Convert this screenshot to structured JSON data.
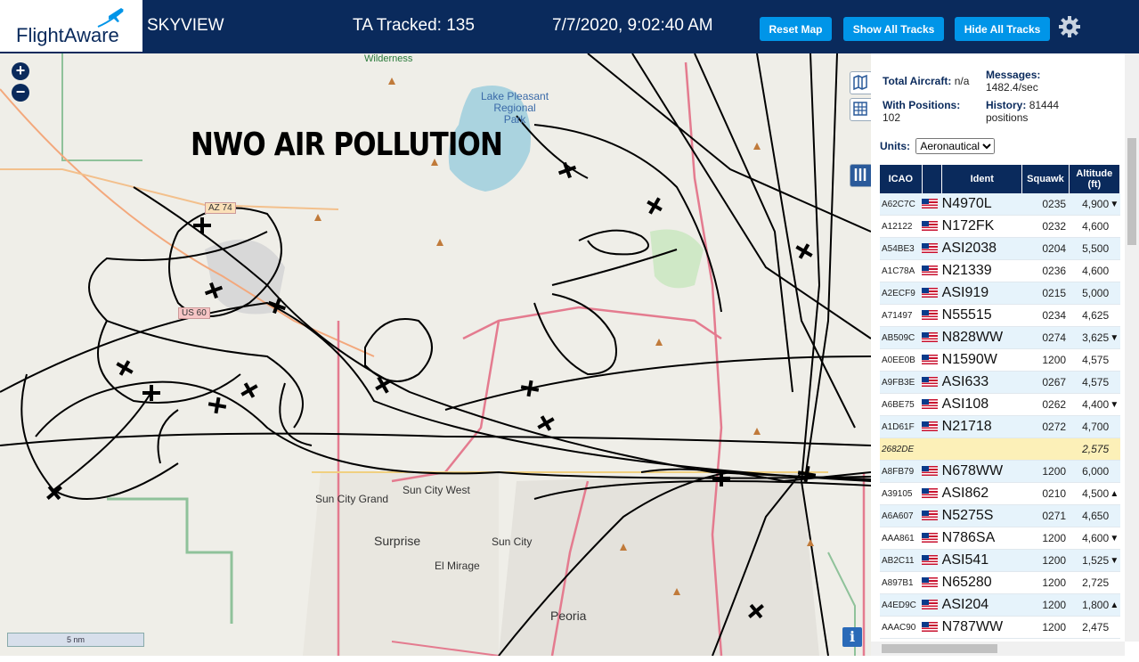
{
  "header": {
    "logo_text": "FlightAware",
    "app_name": "SKYVIEW",
    "ta_tracked": "TA Tracked: 135",
    "datetime": "7/7/2020, 9:02:40 AM",
    "buttons": {
      "reset": "Reset Map",
      "show_all": "Show All Tracks",
      "hide_all": "Hide All Tracks"
    },
    "colors": {
      "bar": "#0a2a5c",
      "button": "#0095e8"
    }
  },
  "map": {
    "overlay_title": "NWO AIR POLLUTION",
    "zoom_in": "+",
    "zoom_out": "−",
    "scale_label": "5 nm",
    "info": "i",
    "labels": {
      "wilderness": "Wilderness",
      "lake1": "Lake Pleasant",
      "lake2": "Regional",
      "lake3": "Park",
      "az74": "AZ 74",
      "us60": "US 60",
      "sun_city_grand": "Sun City Grand",
      "sun_city_west": "Sun City West",
      "sun_city": "Sun City",
      "surprise": "Surprise",
      "el_mirage": "El Mirage",
      "peoria": "Peoria"
    }
  },
  "stats": {
    "total_label": "Total Aircraft:",
    "total_value": "n/a",
    "messages_label": "Messages:",
    "messages_value": "1482.4/sec",
    "positions_label": "With Positions:",
    "positions_value": "102",
    "history_label": "History:",
    "history_value": "81444",
    "history_unit": "positions",
    "units_label": "Units:",
    "units_value": "Aeronautical"
  },
  "table": {
    "headers": {
      "icao": "ICAO",
      "ident": "Ident",
      "squawk": "Squawk",
      "altitude": "Altitude",
      "altitude_unit": "(ft)"
    },
    "rows": [
      {
        "icao": "A62C7C",
        "ident": "N4970L",
        "squawk": "0235",
        "alt": "4,900",
        "trend": "▼"
      },
      {
        "icao": "A12122",
        "ident": "N172FK",
        "squawk": "0232",
        "alt": "4,600",
        "trend": ""
      },
      {
        "icao": "A54BE3",
        "ident": "ASI2038",
        "squawk": "0204",
        "alt": "5,500",
        "trend": ""
      },
      {
        "icao": "A1C78A",
        "ident": "N21339",
        "squawk": "0236",
        "alt": "4,600",
        "trend": ""
      },
      {
        "icao": "A2ECF9",
        "ident": "ASI919",
        "squawk": "0215",
        "alt": "5,000",
        "trend": ""
      },
      {
        "icao": "A71497",
        "ident": "N55515",
        "squawk": "0234",
        "alt": "4,625",
        "trend": ""
      },
      {
        "icao": "AB509C",
        "ident": "N828WW",
        "squawk": "0274",
        "alt": "3,625",
        "trend": "▼"
      },
      {
        "icao": "A0EE0B",
        "ident": "N1590W",
        "squawk": "1200",
        "alt": "4,575",
        "trend": ""
      },
      {
        "icao": "A9FB3E",
        "ident": "ASI633",
        "squawk": "0267",
        "alt": "4,575",
        "trend": ""
      },
      {
        "icao": "A6BE75",
        "ident": "ASI108",
        "squawk": "0262",
        "alt": "4,400",
        "trend": "▼"
      },
      {
        "icao": "A1D61F",
        "ident": "N21718",
        "squawk": "0272",
        "alt": "4,700",
        "trend": ""
      },
      {
        "icao": "2682DE",
        "ident": "",
        "squawk": "",
        "alt": "2,575",
        "trend": "",
        "highlight": true
      },
      {
        "icao": "A8FB79",
        "ident": "N678WW",
        "squawk": "1200",
        "alt": "6,000",
        "trend": ""
      },
      {
        "icao": "A39105",
        "ident": "ASI862",
        "squawk": "0210",
        "alt": "4,500",
        "trend": "▲"
      },
      {
        "icao": "A6A607",
        "ident": "N5275S",
        "squawk": "0271",
        "alt": "4,650",
        "trend": ""
      },
      {
        "icao": "AAA861",
        "ident": "N786SA",
        "squawk": "1200",
        "alt": "4,600",
        "trend": "▼"
      },
      {
        "icao": "AB2C11",
        "ident": "ASI541",
        "squawk": "1200",
        "alt": "1,525",
        "trend": "▼"
      },
      {
        "icao": "A897B1",
        "ident": "N65280",
        "squawk": "1200",
        "alt": "2,725",
        "trend": ""
      },
      {
        "icao": "A4ED9C",
        "ident": "ASI204",
        "squawk": "1200",
        "alt": "1,800",
        "trend": "▲"
      },
      {
        "icao": "AAAC90",
        "ident": "N787WW",
        "squawk": "1200",
        "alt": "2,475",
        "trend": ""
      }
    ]
  }
}
